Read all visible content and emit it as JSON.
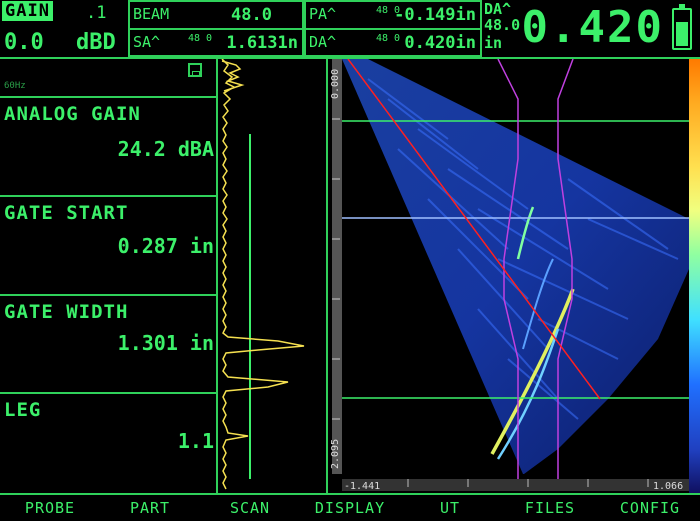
{
  "header": {
    "gain_label": "GAIN",
    "gain_step": ".1",
    "gain_value": "0.0",
    "gain_unit": "dBD",
    "beam_label": "BEAM",
    "beam_value": "48.0",
    "sa_label": "SA^",
    "sa_angle": "48 0",
    "sa_value": "1.6131n",
    "pa_label": "PA^",
    "pa_angle": "48 0",
    "pa_value": "-0.149in",
    "da_label": "DA^",
    "da_angle": "48 0",
    "da_value": "0.420in",
    "big_label": "DA^",
    "big_angle": "48.0",
    "big_unit": "in",
    "big_reading": "0.420",
    "battery_level": 0.7
  },
  "params": {
    "freq": "60Hz",
    "items": [
      {
        "label": "ANALOG GAIN",
        "value": "24.2 dBA"
      },
      {
        "label": "GATE START",
        "value": "0.287 in"
      },
      {
        "label": "GATE WIDTH",
        "value": "1.301 in"
      },
      {
        "label": "LEG",
        "value": "1.1"
      }
    ]
  },
  "sscan": {
    "ruler_top": "0.000",
    "ruler_bottom": "2.095",
    "x_left": "-1.441",
    "x_right": "1.066"
  },
  "menu": [
    "PROBE",
    "PART",
    "SCAN",
    "DISPLAY",
    "UT",
    "FILES",
    "CONFIG"
  ],
  "colors": {
    "ui_green": "#3cf06a",
    "gate_line": "#3cf06a",
    "cursor": "#ff2020",
    "leg_lines": "#c040e0",
    "cursor_h": "#a0c0ff"
  }
}
